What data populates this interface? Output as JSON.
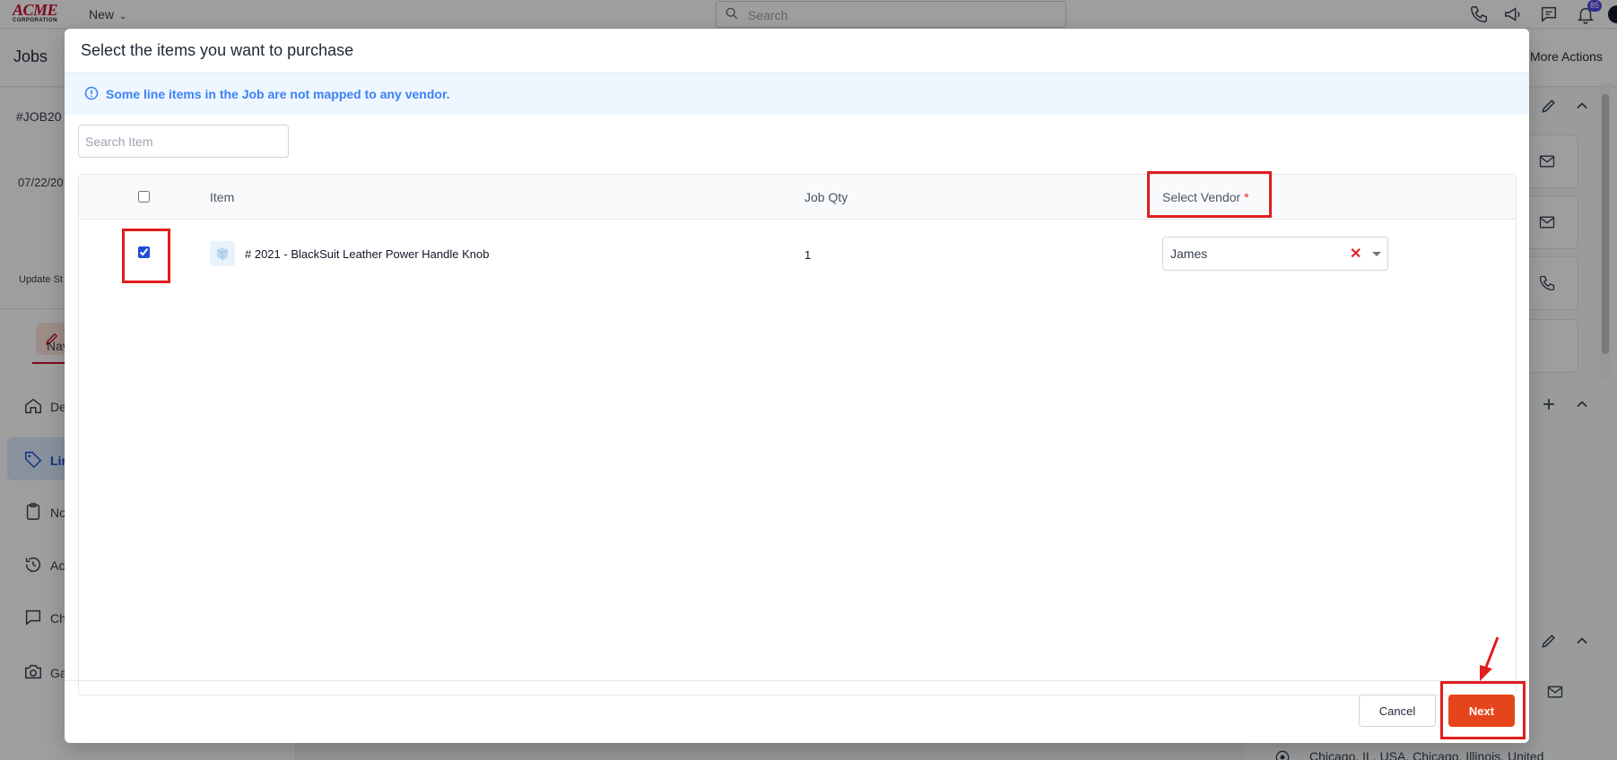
{
  "topbar": {
    "logo_top": "ACME",
    "logo_bottom": "CORPORATION",
    "new_label": "New",
    "search_placeholder": "Search",
    "notification_count": "85",
    "icons": [
      "phone-icon",
      "megaphone-icon",
      "chat-icon",
      "bell-icon"
    ]
  },
  "subbar": {
    "title": "Jobs",
    "more_actions": "More Actions"
  },
  "left_panel": {
    "job_id": "#JOB20",
    "date": "07/22/20",
    "update_status": "Update St",
    "nav_tab": "Nav",
    "nav_items": [
      {
        "label": "De",
        "icon": "home-icon"
      },
      {
        "label": "Lin",
        "icon": "tag-icon"
      },
      {
        "label": "No",
        "icon": "clipboard-icon"
      },
      {
        "label": "Ac",
        "icon": "history-icon"
      },
      {
        "label": "Ch",
        "icon": "chat-icon"
      },
      {
        "label": "Ga",
        "icon": "camera-icon"
      }
    ]
  },
  "right_panel": {
    "address_fragment": "Chicago, IL, USA, Chicago, Illinois, United"
  },
  "modal": {
    "title": "Select the items you want to purchase",
    "alert_text": "Some line items in the Job are not mapped to any vendor.",
    "search_placeholder": "Search Item",
    "columns": {
      "item": "Item",
      "job_qty": "Job Qty",
      "select_vendor": "Select Vendor",
      "required_mark": "*"
    },
    "rows": [
      {
        "checked": true,
        "item_name": "# 2021 - BlackSuit Leather Power Handle Knob",
        "job_qty": "1",
        "vendor": "James"
      }
    ],
    "cancel_label": "Cancel",
    "next_label": "Next"
  },
  "colors": {
    "accent_next": "#e5451b",
    "alert_text": "#3b82f6",
    "alert_bg": "#eef6ff",
    "annotation_red": "#e11d1d"
  }
}
